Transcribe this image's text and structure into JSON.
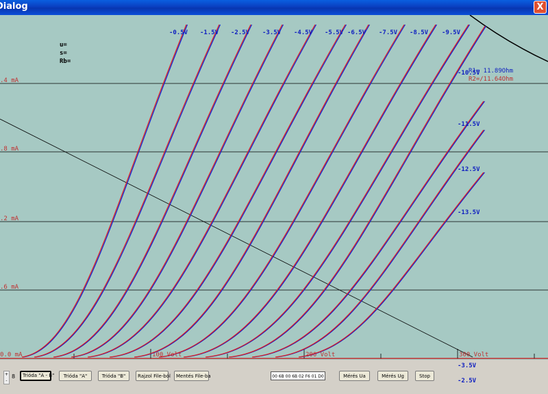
{
  "window": {
    "title": "Dialog",
    "close_glyph": "X"
  },
  "plot": {
    "info": [
      "u=",
      "s=",
      "Rb="
    ],
    "grid_labels": [
      ".4 mA",
      ".8 mA",
      ".2 mA",
      ".6 mA",
      "0.0 mA"
    ],
    "x_labels": [
      "100 Volt",
      "200 Volt",
      "300 Volt"
    ],
    "top_grid_labels": [
      "-0.5V",
      "-1.5V",
      "-2.5V",
      "-3.5V",
      "-4.5V",
      "-5.5V",
      "-6.5V",
      "-7.5V",
      "-8.5V",
      "-9.5V"
    ],
    "side_grid_labels": [
      "-10.5V",
      "-11.5V",
      "-12.5V",
      "-13.5V"
    ],
    "r1": "R1= 11.89Ohm",
    "r2": "R2=/11.64Ohm",
    "colors": {
      "bg": "#a6c9c3",
      "curve_a": "#e02020",
      "curve_b": "#1020d0",
      "grid": "#000000",
      "label_red": "#c03030",
      "label_blue": "#1020c0"
    }
  },
  "bottom": {
    "spin_value": "8",
    "buttons": [
      "Trióda \"A - B\"",
      "Trióda \"A\"",
      "Trióda \"B\"",
      "Rajzol File-ból",
      "Mentés File-ba",
      "Mérés Ua",
      "Mérés Ug",
      "Stop"
    ],
    "hex": "00 6B 00 6B 02 F6 01 D0",
    "grid_readout_1": "-3.5V",
    "grid_readout_2": "-2.5V"
  }
}
